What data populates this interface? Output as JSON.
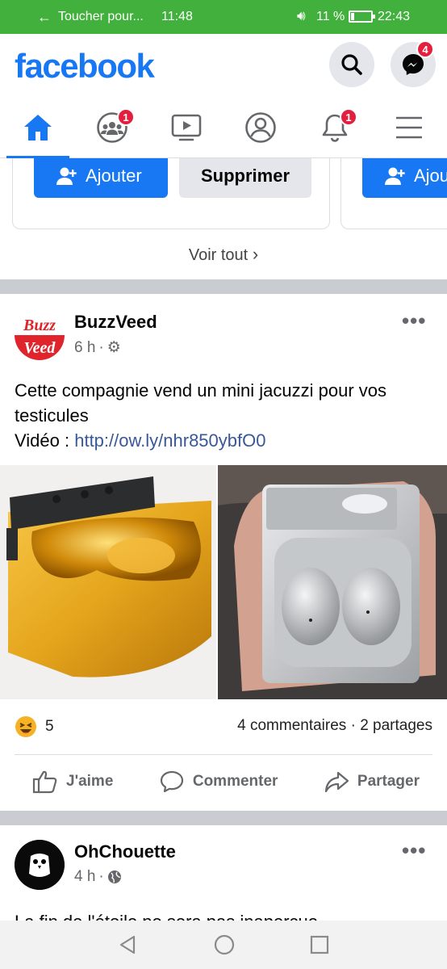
{
  "status_bar": {
    "app_name": "Toucher pour...",
    "time_left": "11:48",
    "battery": "11 %",
    "time": "22:43",
    "bg_color": "#41b03c"
  },
  "header": {
    "logo": "facebook",
    "brand_color": "#1877f2",
    "messenger_badge": "4"
  },
  "nav": {
    "tabs": [
      {
        "name": "home",
        "icon": "home-icon",
        "badge": ""
      },
      {
        "name": "groups",
        "icon": "groups-icon",
        "badge": "1"
      },
      {
        "name": "watch",
        "icon": "video-icon",
        "badge": ""
      },
      {
        "name": "profile",
        "icon": "profile-icon",
        "badge": ""
      },
      {
        "name": "notifications",
        "icon": "bell-icon",
        "badge": "1"
      },
      {
        "name": "menu",
        "icon": "hamburger-icon",
        "badge": ""
      }
    ]
  },
  "suggestions": {
    "add_label": "Ajouter",
    "add_label_partial": "Ajou",
    "delete_label": "Supprimer",
    "see_all": "Voir tout"
  },
  "post1": {
    "author": "BuzzVeed",
    "avatar_top": "Buzz",
    "avatar_bottom": "Veed",
    "time": "6 h",
    "text": "Cette compagnie vend un mini jacuzzi pour vos testicules",
    "video_prefix": "Vidéo : ",
    "link": "http://ow.ly/nhr850ybfO0",
    "reactions_count": "5",
    "comments": "4 commentaires",
    "shares": "2 partages",
    "like_label": "J'aime",
    "comment_label": "Commenter",
    "share_label": "Partager"
  },
  "post2": {
    "author": "OhChouette",
    "time": "4 h",
    "text_partial": "La fin de l'étoile ne sera pas inaperçue"
  }
}
